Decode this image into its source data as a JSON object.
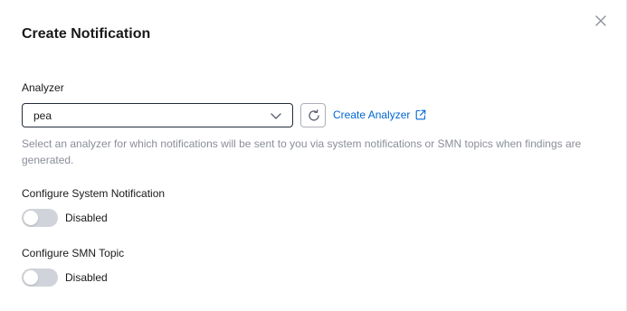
{
  "dialog": {
    "title": "Create Notification",
    "close_icon": "close-icon"
  },
  "analyzer": {
    "label": "Analyzer",
    "selected_value": "pea",
    "chevron_icon": "chevron-down-icon",
    "refresh_icon": "refresh-icon",
    "create_link_label": "Create Analyzer",
    "external_icon": "external-link-icon",
    "helper_text": "Select an analyzer for which notifications will be sent to you via system notifications or SMN topics when findings are generated."
  },
  "system_notification": {
    "label": "Configure System Notification",
    "enabled": false,
    "status_text": "Disabled"
  },
  "smn_topic": {
    "label": "Configure SMN Topic",
    "enabled": false,
    "status_text": "Disabled"
  },
  "colors": {
    "link": "#0067d1",
    "toggle_off": "#d0d3d9",
    "helper_text": "#8a8e99"
  }
}
